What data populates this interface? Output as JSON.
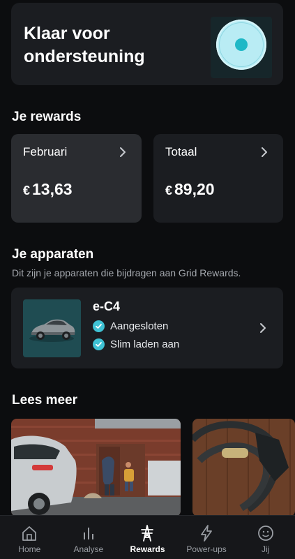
{
  "status": {
    "title": "Klaar voor ondersteuning"
  },
  "rewards": {
    "title": "Je rewards",
    "cards": [
      {
        "label": "Februari",
        "currency": "€",
        "amount": "13,63"
      },
      {
        "label": "Totaal",
        "currency": "€",
        "amount": "89,20"
      }
    ]
  },
  "devices": {
    "title": "Je apparaten",
    "subtitle": "Dit zijn je apparaten die bijdragen aan Grid Rewards.",
    "items": [
      {
        "name": "e-C4",
        "statuses": [
          "Aangesloten",
          "Slim laden aan"
        ]
      }
    ]
  },
  "read_more": {
    "title": "Lees meer"
  },
  "tabs": [
    {
      "label": "Home",
      "icon": "home-icon",
      "active": false
    },
    {
      "label": "Analyse",
      "icon": "bar-chart-icon",
      "active": false
    },
    {
      "label": "Rewards",
      "icon": "pylon-icon",
      "active": true
    },
    {
      "label": "Power-ups",
      "icon": "lightning-icon",
      "active": false
    },
    {
      "label": "Jij",
      "icon": "profile-icon",
      "active": false
    }
  ],
  "colors": {
    "accent": "#3fc2d4",
    "background": "#0c0d0f",
    "card": "#1b1d21",
    "card_selected": "#2a2c30"
  }
}
